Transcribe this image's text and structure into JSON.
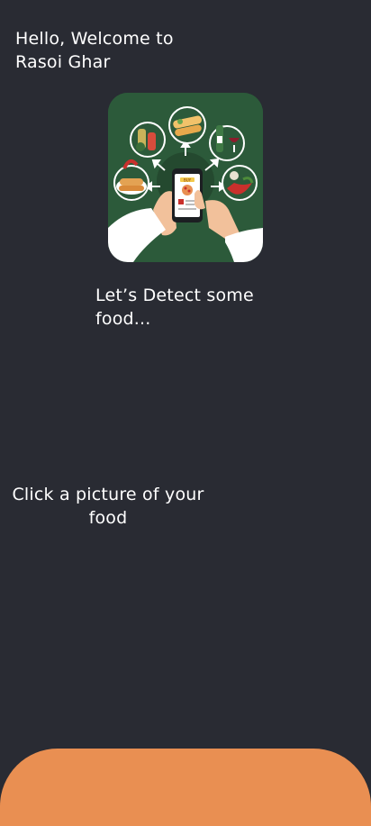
{
  "header": {
    "welcome_text": "Hello, Welcome to Rasoi Ghar"
  },
  "hero": {
    "image_name": "food-detection-phone-illustration",
    "menu_card_label": "BUY"
  },
  "main": {
    "detect_text": "Let’s Detect some food...",
    "prompt_text": "Click a picture of your food"
  },
  "colors": {
    "background": "#292b33",
    "text": "#ffffff",
    "hero_background": "#2c5a3a",
    "bottom_panel": "#e98f52"
  }
}
